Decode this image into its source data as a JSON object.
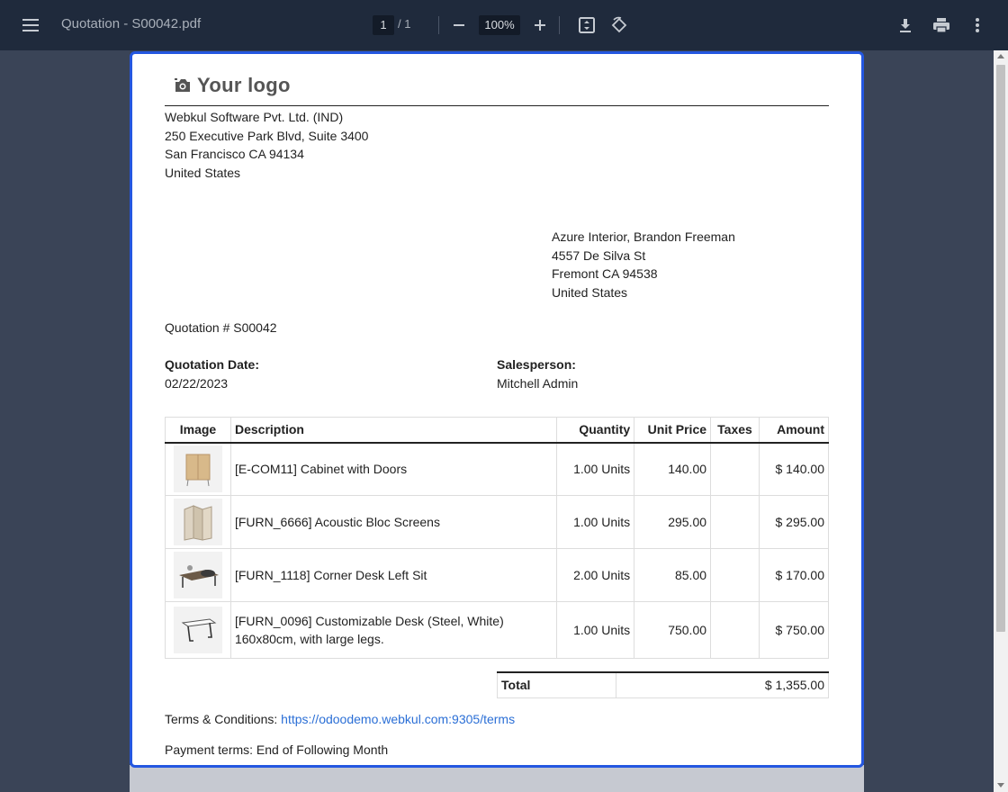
{
  "toolbar": {
    "title": "Quotation - S00042.pdf",
    "page_current": "1",
    "page_total": "/  1",
    "zoom": "100%",
    "icons": [
      "menu-icon",
      "zoom-out-icon",
      "zoom-in-icon",
      "fit-page-icon",
      "rotate-icon",
      "download-icon",
      "print-icon",
      "more-vert-icon"
    ]
  },
  "document": {
    "logo_text": "Your logo",
    "company": [
      "Webkul Software Pvt. Ltd. (IND)",
      "250 Executive Park Blvd, Suite 3400",
      "San Francisco CA 94134",
      "United States"
    ],
    "customer": [
      "Azure Interior, Brandon Freeman",
      "4557 De Silva St",
      "Fremont CA 94538",
      "United States"
    ],
    "quotation_number": "Quotation # S00042",
    "date_label": "Quotation Date:",
    "date_value": "02/22/2023",
    "salesperson_label": "Salesperson:",
    "salesperson_value": "Mitchell Admin",
    "table_headers": [
      "Image",
      "Description",
      "Quantity",
      "Unit Price",
      "Taxes",
      "Amount"
    ],
    "lines": [
      {
        "description": "[E-COM11] Cabinet with Doors",
        "quantity": "1.00 Units",
        "unit_price": "140.00",
        "taxes": "",
        "amount": "$ 140.00"
      },
      {
        "description": "[FURN_6666] Acoustic Bloc Screens",
        "quantity": "1.00 Units",
        "unit_price": "295.00",
        "taxes": "",
        "amount": "$ 295.00"
      },
      {
        "description": "[FURN_1118] Corner Desk Left Sit",
        "quantity": "2.00 Units",
        "unit_price": "85.00",
        "taxes": "",
        "amount": "$ 170.00"
      },
      {
        "description": "[FURN_0096] Customizable Desk (Steel, White)",
        "description_line2": "160x80cm, with large legs.",
        "quantity": "1.00 Units",
        "unit_price": "750.00",
        "taxes": "",
        "amount": "$ 750.00"
      }
    ],
    "total_label": "Total",
    "total_value": "$ 1,355.00",
    "terms_label": "Terms & Conditions:",
    "terms_link": "https://odoodemo.webkul.com:9305/terms",
    "payment_terms": "Payment terms: End of Following Month"
  },
  "colors": {
    "toolbar_bg": "#1f2a3c",
    "viewer_bg": "#3a4457",
    "page_border": "#2457e0",
    "link": "#2b6fd6"
  }
}
